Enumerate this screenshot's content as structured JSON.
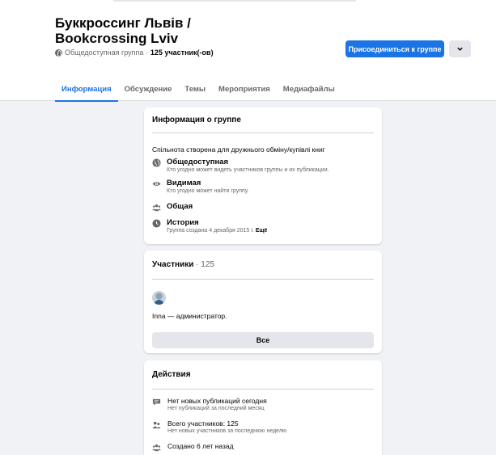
{
  "group": {
    "title": "Буккроссинг Львів / Bookcrossing Lviv",
    "privacy": "Общедоступная группа ·",
    "members": "125 участник(-ов)"
  },
  "header_actions": {
    "join": "Присоединиться к группе",
    "more_icon": "chevron-down-icon"
  },
  "tabs": [
    {
      "label": "Информация",
      "active": true
    },
    {
      "label": "Обсуждение",
      "active": false
    },
    {
      "label": "Темы",
      "active": false
    },
    {
      "label": "Мероприятия",
      "active": false
    },
    {
      "label": "Медиафайлы",
      "active": false
    }
  ],
  "about": {
    "title": "Информация о группе",
    "description": "Спільнота створена для дружнього обміну/купівлі книг",
    "items": [
      {
        "icon": "globe-icon",
        "title": "Общедоступная",
        "sub": "Кто угодно может видеть участников группы и их публикации."
      },
      {
        "icon": "eye-icon",
        "title": "Видимая",
        "sub": "Кто угодно может найти группу."
      },
      {
        "icon": "people-icon",
        "title": "Общая",
        "sub": ""
      },
      {
        "icon": "clock-icon",
        "title": "История",
        "sub": "Группа создана 4 декабря 2015 г.",
        "more": "Ещё"
      }
    ]
  },
  "members_card": {
    "title": "Участники",
    "count": "· 125",
    "admin": "Inna — администратор.",
    "all_button": "Все"
  },
  "actions_card": {
    "title": "Действия",
    "items": [
      {
        "icon": "chat-icon",
        "main": "Нет новых публикаций сегодня",
        "sub": "Нет публикаций за последний месяц"
      },
      {
        "icon": "people-icon",
        "main": "Всего участников: 125",
        "sub": "Нет новых участников за последнюю неделю"
      },
      {
        "icon": "people-group-icon",
        "main": "Создано 6 лет назад",
        "sub": ""
      }
    ]
  },
  "colors": {
    "accent": "#1b74e4",
    "background": "#f0f2f5",
    "muted": "#65676b"
  }
}
